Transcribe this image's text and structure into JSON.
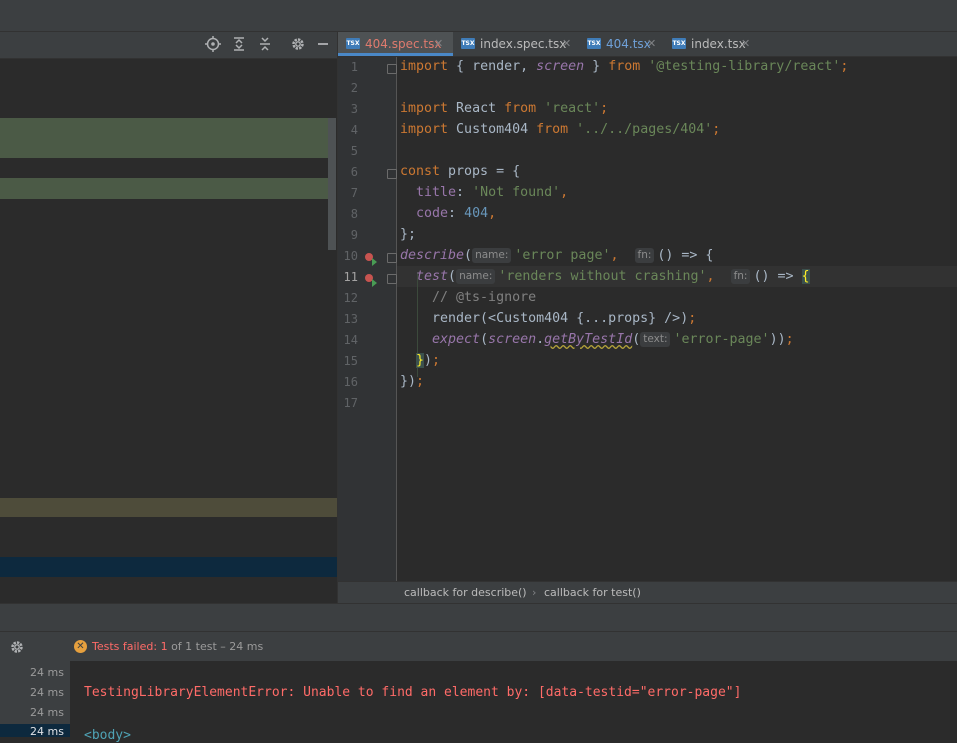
{
  "colors": {
    "accent": "#4a88c7",
    "error": "#ff6b68",
    "failed_badge": "#e6a03e"
  },
  "left_toolbar": {
    "icons": [
      "locate-icon",
      "expand-all-icon",
      "collapse-all-icon",
      "gear-icon",
      "minimize-icon"
    ]
  },
  "tabs": [
    {
      "label": "404.spec.tsx",
      "badge": "TSX",
      "active": true
    },
    {
      "label": "index.spec.tsx",
      "badge": "TSX",
      "active": false
    },
    {
      "label": "404.tsx",
      "badge": "TSX",
      "active": false
    },
    {
      "label": "index.tsx",
      "badge": "TSX",
      "active": false
    }
  ],
  "editor": {
    "line_numbers": [
      "1",
      "2",
      "3",
      "4",
      "5",
      "6",
      "7",
      "8",
      "9",
      "10",
      "11",
      "12",
      "13",
      "14",
      "15",
      "16",
      "17"
    ],
    "lines": {
      "l1_a": "import",
      "l1_b": " { render, ",
      "l1_c": "screen",
      "l1_d": " } ",
      "l1_e": "from",
      "l1_f": " '@testing-library/react'",
      "l1_g": ";",
      "l3_a": "import",
      "l3_b": " React ",
      "l3_c": "from",
      "l3_d": " 'react'",
      "l3_e": ";",
      "l4_a": "import",
      "l4_b": " Custom404 ",
      "l4_c": "from",
      "l4_d": " '../../pages/404'",
      "l4_e": ";",
      "l6_a": "const",
      "l6_b": " props = {",
      "l7_a": "  title",
      "l7_b": ": ",
      "l7_c": "'Not found'",
      "l7_d": ",",
      "l8_a": "  code",
      "l8_b": ": ",
      "l8_c": "404",
      "l8_d": ",",
      "l9_a": "};",
      "l10_a": "describe",
      "l10_b": "(",
      "l10_hint1": "name:",
      "l10_c": "'error page'",
      "l10_d": ",  ",
      "l10_hint2": "fn:",
      "l10_e": "() => {",
      "l11_a": "  test",
      "l11_b": "(",
      "l11_hint1": "name:",
      "l11_c": "'renders without crashing'",
      "l11_d": ",  ",
      "l11_hint2": "fn:",
      "l11_e": "() => ",
      "l11_f": "{",
      "l12_a": "    // @ts-ignore",
      "l13_a": "    render(<Custom404 {...props} />)",
      "l13_b": ";",
      "l14_a": "    expect",
      "l14_b": "(",
      "l14_c": "screen",
      "l14_d": ".",
      "l14_e": "getByTestId",
      "l14_f": "(",
      "l14_hint": "text:",
      "l14_g": "'error-page'",
      "l14_h": "))",
      "l14_i": ";",
      "l15_a": "  ",
      "l15_b": "}",
      "l15_c": ")",
      "l15_d": ";",
      "l16_a": "})",
      "l16_b": ";"
    }
  },
  "breadcrumb": {
    "item1": "callback for describe()",
    "item2": "callback for test()"
  },
  "run": {
    "status_prefix": "Tests failed: ",
    "failed_count": "1",
    "status_suffix": " of 1 test – 24 ms",
    "durations": [
      "24 ms",
      "24 ms",
      "24 ms",
      "24 ms"
    ],
    "error_text": "TestingLibraryElementError: Unable to find an element by: [data-testid=\"error-page\"]",
    "body_tag": "<body>"
  }
}
